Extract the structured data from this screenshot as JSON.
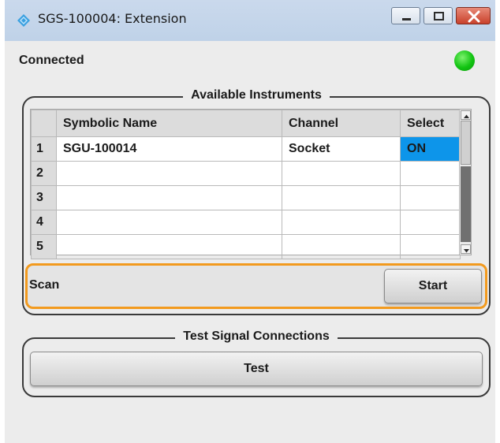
{
  "window": {
    "title": "SGS-100004: Extension",
    "controls": [
      "minimize",
      "maximize",
      "close"
    ]
  },
  "status": {
    "label": "Connected",
    "indicator_color": "#12c412"
  },
  "instruments": {
    "group_title": "Available Instruments",
    "columns": [
      "",
      "Symbolic Name",
      "Channel",
      "Select"
    ],
    "rows": [
      {
        "num": "1",
        "name": "SGU-100014",
        "channel": "Socket",
        "select": "ON"
      },
      {
        "num": "2",
        "name": "",
        "channel": "",
        "select": ""
      },
      {
        "num": "3",
        "name": "",
        "channel": "",
        "select": ""
      },
      {
        "num": "4",
        "name": "",
        "channel": "",
        "select": ""
      },
      {
        "num": "5",
        "name": "",
        "channel": "",
        "select": ""
      }
    ],
    "selected_color": "#0d95ea"
  },
  "scan": {
    "label": "Scan",
    "button_label": "Start",
    "highlight_color": "#f29a1e"
  },
  "test_signal": {
    "group_title": "Test Signal Connections",
    "button_label": "Test"
  }
}
